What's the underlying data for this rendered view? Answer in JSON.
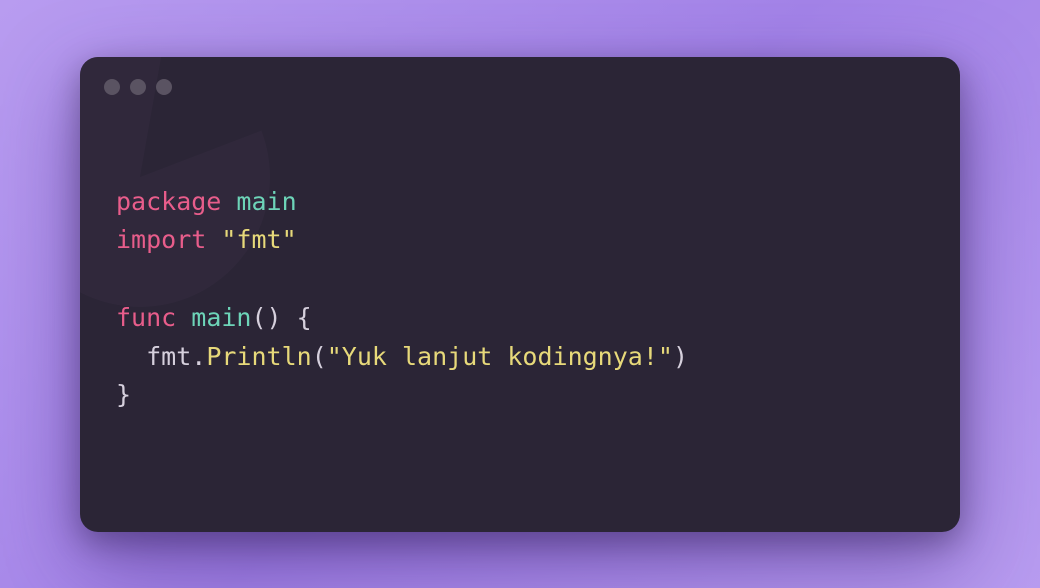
{
  "code": {
    "line1": {
      "keyword": "package",
      "ident": "main"
    },
    "line2": {
      "keyword": "import",
      "string": "\"fmt\""
    },
    "line4": {
      "keyword": "func",
      "funcname": "main",
      "parens": "() {"
    },
    "line5": {
      "indent": "  ",
      "obj": "fmt",
      "dot": ".",
      "method": "Println",
      "open": "(",
      "string": "\"Yuk lanjut kodingnya!\"",
      "close": ")"
    },
    "line6": {
      "brace": "}"
    }
  }
}
